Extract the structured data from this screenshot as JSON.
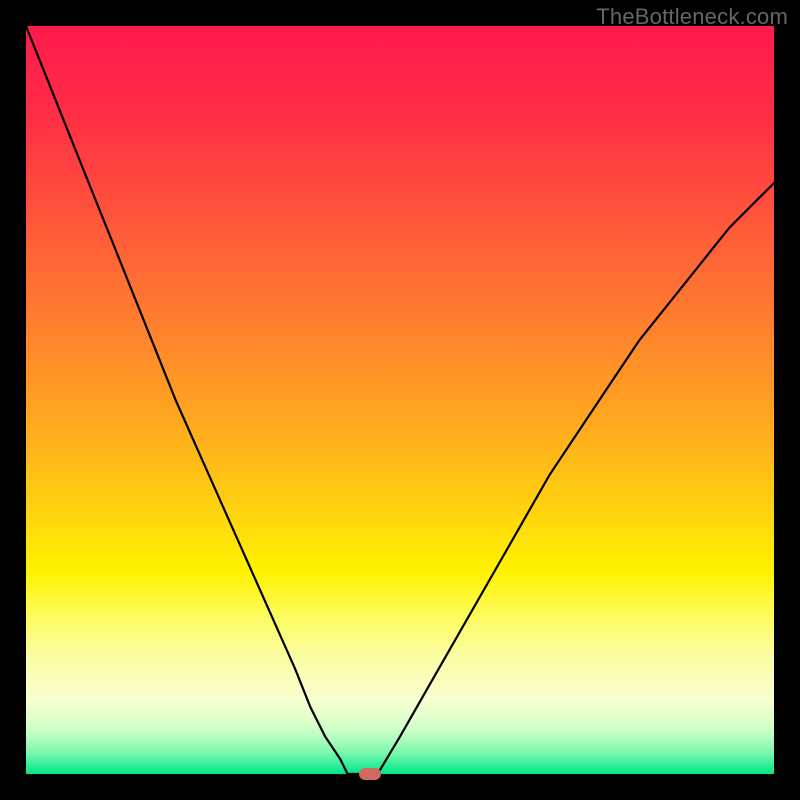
{
  "watermark": "TheBottleneck.com",
  "colors": {
    "frame_bg": "#000000",
    "marker": "#d06a60",
    "curve_stroke": "#000000"
  },
  "chart_data": {
    "type": "line",
    "title": "",
    "xlabel": "",
    "ylabel": "",
    "xlim": [
      0,
      100
    ],
    "ylim": [
      0,
      100
    ],
    "grid": false,
    "series": [
      {
        "name": "left-branch",
        "x": [
          0,
          4,
          8,
          12,
          16,
          20,
          24,
          28,
          32,
          36,
          38,
          40,
          42,
          43
        ],
        "y": [
          100,
          90,
          80,
          70,
          60,
          50,
          41,
          32,
          23,
          14,
          9,
          5,
          2,
          0
        ]
      },
      {
        "name": "flat-bottom",
        "x": [
          43,
          44,
          45,
          46,
          47
        ],
        "y": [
          0,
          0,
          0,
          0,
          0
        ]
      },
      {
        "name": "right-branch",
        "x": [
          47,
          50,
          54,
          58,
          62,
          66,
          70,
          74,
          78,
          82,
          86,
          90,
          94,
          98,
          100
        ],
        "y": [
          0,
          5,
          12,
          19,
          26,
          33,
          40,
          46,
          52,
          58,
          63,
          68,
          73,
          77,
          79
        ]
      }
    ],
    "markers": [
      {
        "name": "optimum-marker",
        "x": 46,
        "y": 0
      }
    ],
    "gradient_stops": [
      {
        "pos": 0.0,
        "color": "#ff1a4d"
      },
      {
        "pos": 0.4,
        "color": "#ff8a28"
      },
      {
        "pos": 0.72,
        "color": "#fff200"
      },
      {
        "pos": 0.92,
        "color": "#f4ffbf"
      },
      {
        "pos": 1.0,
        "color": "#00e58a"
      }
    ]
  }
}
